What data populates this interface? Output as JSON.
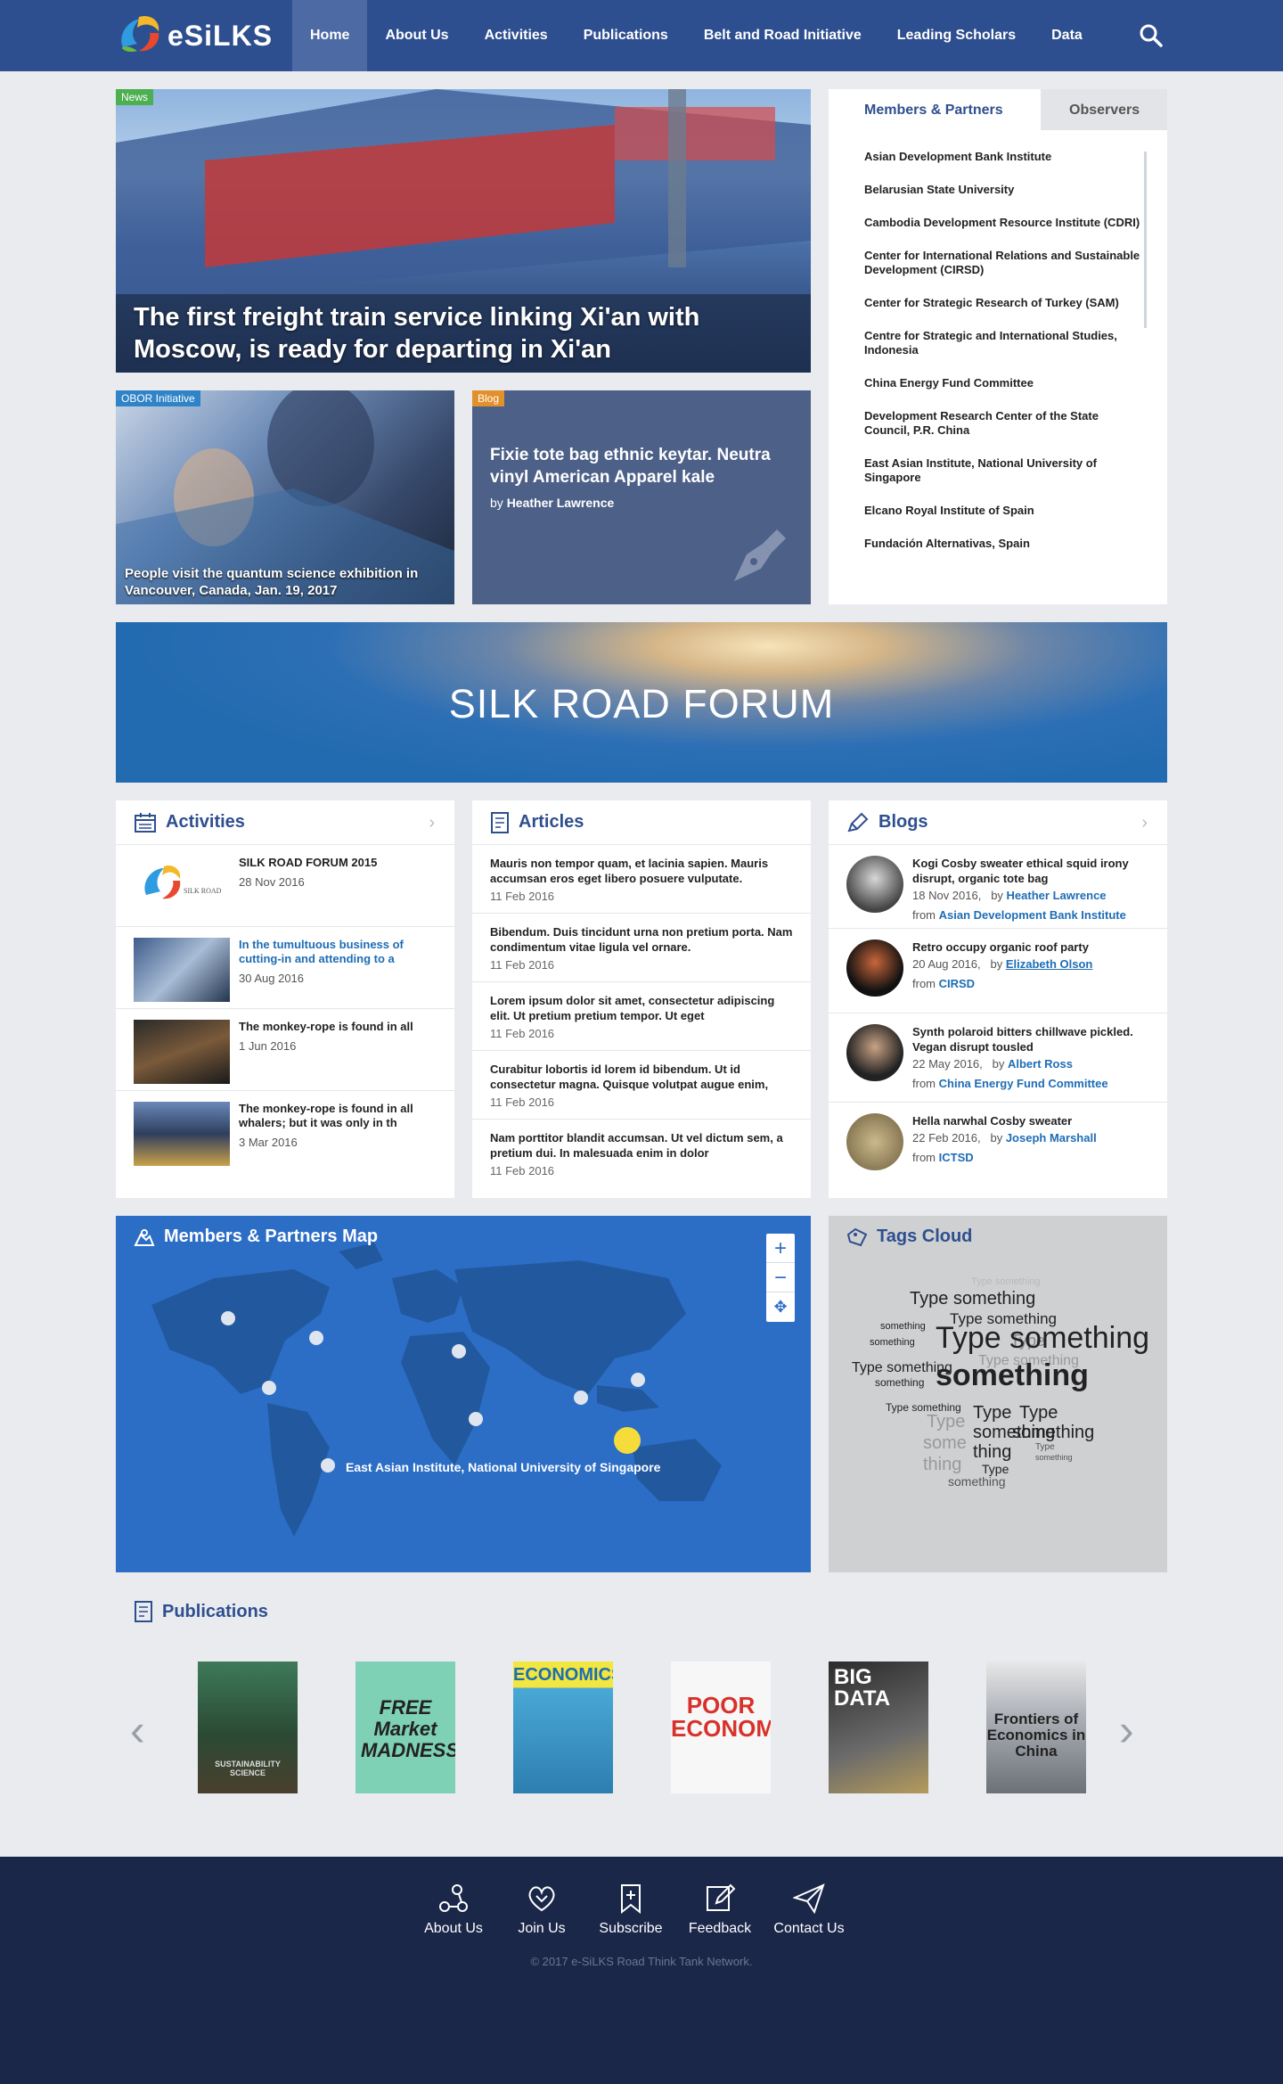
{
  "nav": {
    "logo": "eSiLKS",
    "items": [
      "Home",
      "About Us",
      "Activities",
      "Publications",
      "Belt and Road Initiative",
      "Leading Scholars",
      "Data"
    ],
    "active": "Home"
  },
  "hero": {
    "tag": "News",
    "title": "The first freight train service linking Xi'an with Moscow,  is ready for departing in Xi'an"
  },
  "obor": {
    "tag": "OBOR Initiative",
    "caption": "People visit the quantum science exhibition in Vancouver, Canada, Jan. 19, 2017"
  },
  "blog_card": {
    "tag": "Blog",
    "title": "Fixie tote bag ethnic keytar. Neutra vinyl American Apparel kale",
    "by": "by",
    "author": "Heather Lawrence"
  },
  "members": {
    "tab_active": "Members & Partners",
    "tab_inactive": "Observers",
    "items": [
      "Asian Development Bank Institute",
      "Belarusian State University",
      "Cambodia Development Resource Institute (CDRI)",
      "Center for International Relations and Sustainable Development (CIRSD)",
      "Center for Strategic Research of Turkey (SAM)",
      "Centre for Strategic and International Studies, Indonesia",
      "China Energy Fund Committee",
      "Development Research Center of the State Council, P.R. China",
      "East Asian Institute, National University of Singapore",
      "Elcano Royal Institute of Spain",
      "Fundación Alternativas, Spain"
    ]
  },
  "banner": "SILK ROAD FORUM",
  "activities": {
    "title": "Activities",
    "items": [
      {
        "title": "SILK ROAD FORUM 2015",
        "date": "28 Nov 2016"
      },
      {
        "title": "In the tumultuous business of cutting-in and attending to a",
        "date": "30 Aug 2016"
      },
      {
        "title": "The monkey-rope is found in all",
        "date": "1 Jun 2016"
      },
      {
        "title": "The monkey-rope is found in all whalers; but it was only in th",
        "date": "3 Mar 2016"
      }
    ]
  },
  "articles": {
    "title": "Articles",
    "items": [
      {
        "title": "Mauris non tempor quam, et lacinia sapien. Mauris accumsan eros eget libero posuere vulputate.",
        "date": "11 Feb 2016"
      },
      {
        "title": "Bibendum. Duis tincidunt urna non pretium porta. Nam condimentum vitae ligula vel ornare.",
        "date": "11 Feb 2016"
      },
      {
        "title": "Lorem ipsum dolor sit amet, consectetur adipiscing elit. Ut pretium pretium tempor. Ut eget",
        "date": "11 Feb 2016"
      },
      {
        "title": "Curabitur lobortis id lorem id bibendum. Ut id consectetur magna. Quisque volutpat augue enim,",
        "date": "11 Feb 2016"
      },
      {
        "title": "Nam porttitor blandit accumsan. Ut vel dictum sem, a pretium dui. In malesuada enim in dolor",
        "date": "11 Feb 2016"
      }
    ]
  },
  "blogs": {
    "title": "Blogs",
    "items": [
      {
        "title": "Kogi Cosby sweater ethical squid irony disrupt, organic tote bag",
        "date": "18 Nov 2016,",
        "author": "Heather Lawrence",
        "from": "Asian Development Bank Institute"
      },
      {
        "title": "Retro occupy organic roof party",
        "date": "20 Aug 2016,",
        "author": "Elizabeth Olson",
        "from": "CIRSD"
      },
      {
        "title": "Synth polaroid bitters chillwave pickled. Vegan disrupt tousled",
        "date": "22 May 2016,",
        "author": "Albert Ross",
        "from": "China Energy Fund Committee"
      },
      {
        "title": "Hella narwhal Cosby sweater",
        "date": "22 Feb 2016,",
        "author": "Joseph Marshall",
        "from": "ICTSD"
      }
    ],
    "by": "by",
    "from": "from"
  },
  "map": {
    "title": "Members & Partners Map",
    "label": "East Asian Institute, National University of Singapore",
    "zoom_in": "+",
    "zoom_out": "−",
    "pan": "✥"
  },
  "tags": {
    "title": "Tags Cloud",
    "words": [
      "Type something",
      "Type something",
      "Type something",
      "Type",
      "Type something",
      "something",
      "Type something",
      "something",
      "something",
      "something",
      "Type something",
      "Type",
      "Type",
      "Type",
      "something",
      "some",
      "thing",
      "thing",
      "Type",
      "Type",
      "something",
      "something",
      "something",
      "Type something"
    ]
  },
  "publications": {
    "title": "Publications",
    "books": [
      {
        "title": "SUSTAINABILITY SCIENCE",
        "color": "#2f5a3a"
      },
      {
        "title": "FREE Market MADNESS",
        "color": "#6fc3a8"
      },
      {
        "title": "ECONOMICS",
        "color": "#3aa0c8"
      },
      {
        "title": "POOR ECONOMICS",
        "color": "#f2f2f2"
      },
      {
        "title": "BIG DATA",
        "color": "#3a3a3a"
      },
      {
        "title": "Frontiers of Economics in China",
        "color": "#8a8e94"
      }
    ]
  },
  "footer": {
    "items": [
      "About Us",
      "Join Us",
      "Subscribe",
      "Feedback",
      "Contact Us"
    ],
    "copyright": "© 2017 e-SiLKS Road Think Tank Network."
  }
}
